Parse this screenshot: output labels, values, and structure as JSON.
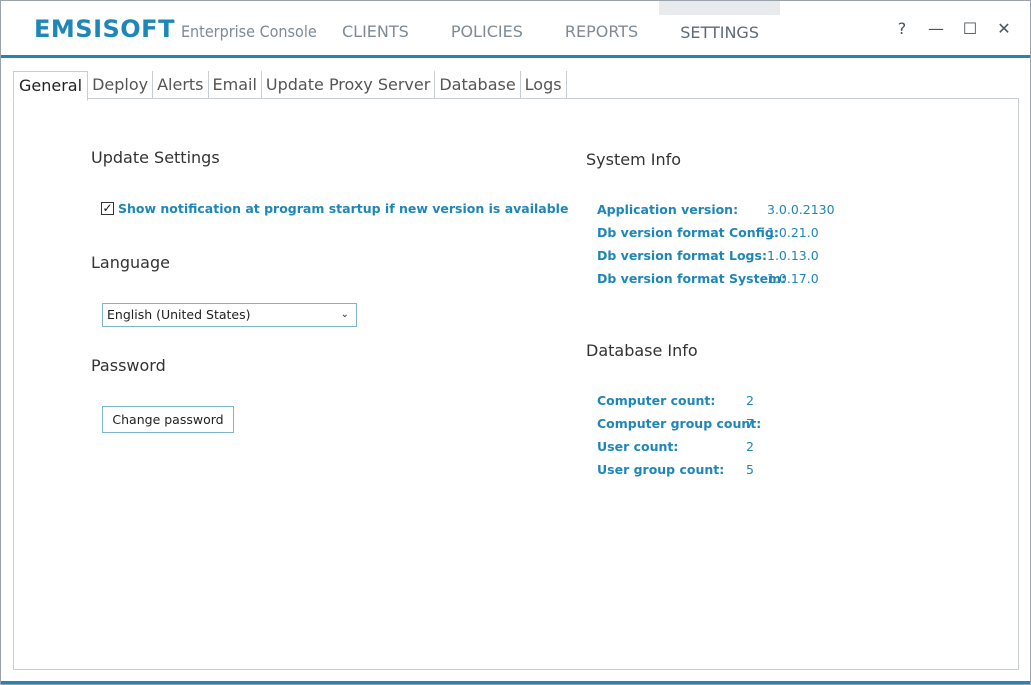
{
  "app": {
    "brand": "EMSISOFT",
    "product": "Enterprise Console"
  },
  "nav": {
    "items": [
      "CLIENTS",
      "POLICIES",
      "REPORTS",
      "SETTINGS"
    ],
    "active": "SETTINGS"
  },
  "window_controls": {
    "help": "?",
    "minimize": "—",
    "maximize": "☐",
    "close": "✕"
  },
  "subtabs": [
    "General",
    "Deploy",
    "Alerts",
    "Email",
    "Update Proxy Server",
    "Database",
    "Logs"
  ],
  "update_settings": {
    "title": "Update Settings",
    "checkbox_label": "Show notification at program startup if new version is available",
    "checked": true
  },
  "language": {
    "title": "Language",
    "selected": "English (United States)"
  },
  "password": {
    "title": "Password",
    "button_label": "Change password"
  },
  "system_info": {
    "title": "System Info",
    "rows": [
      {
        "label": "Application version:",
        "value": "3.0.0.2130"
      },
      {
        "label": "Db version format Config:",
        "value": "1.0.21.0"
      },
      {
        "label": "Db version format Logs:",
        "value": "1.0.13.0"
      },
      {
        "label": "Db version format System:",
        "value": "1.0.17.0"
      }
    ]
  },
  "database_info": {
    "title": "Database Info",
    "rows": [
      {
        "label": "Computer count:",
        "value": "2"
      },
      {
        "label": "Computer group count:",
        "value": "7"
      },
      {
        "label": "User count:",
        "value": "2"
      },
      {
        "label": "User group count:",
        "value": "5"
      }
    ]
  },
  "colors": {
    "accent": "#1f86b8",
    "nav_text": "#7d8b96"
  }
}
